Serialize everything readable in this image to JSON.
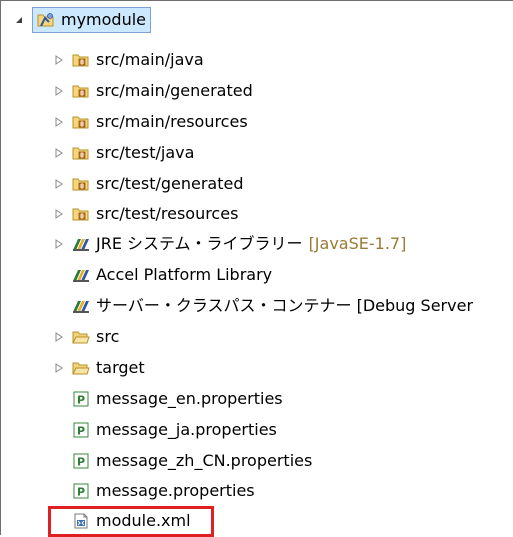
{
  "tree": {
    "root": {
      "label": "mymodule",
      "icon": "project-folder-icon",
      "expanded": true
    },
    "items": [
      {
        "label": "src/main/java",
        "icon": "source-folder-icon",
        "expandable": true
      },
      {
        "label": "src/main/generated",
        "icon": "source-folder-icon",
        "expandable": true
      },
      {
        "label": "src/main/resources",
        "icon": "source-folder-icon",
        "expandable": true
      },
      {
        "label": "src/test/java",
        "icon": "source-folder-icon",
        "expandable": true
      },
      {
        "label": "src/test/generated",
        "icon": "source-folder-icon",
        "expandable": true
      },
      {
        "label": "src/test/resources",
        "icon": "source-folder-icon",
        "expandable": true
      },
      {
        "label": "JRE システム・ライブラリー",
        "decoration": "[JavaSE-1.7]",
        "icon": "library-icon",
        "expandable": true
      },
      {
        "label": "Accel Platform Library",
        "icon": "library-icon",
        "expandable": false
      },
      {
        "label": "サーバー・クラスパス・コンテナー [Debug Server",
        "icon": "library-icon",
        "expandable": false
      },
      {
        "label": "src",
        "icon": "folder-icon",
        "expandable": true
      },
      {
        "label": "target",
        "icon": "folder-icon",
        "expandable": true
      },
      {
        "label": "message_en.properties",
        "icon": "properties-file-icon",
        "expandable": false
      },
      {
        "label": "message_ja.properties",
        "icon": "properties-file-icon",
        "expandable": false
      },
      {
        "label": "message_zh_CN.properties",
        "icon": "properties-file-icon",
        "expandable": false
      },
      {
        "label": "message.properties",
        "icon": "properties-file-icon",
        "expandable": false
      },
      {
        "label": "module.xml",
        "icon": "xml-file-icon",
        "expandable": false,
        "highlighted": true
      }
    ]
  },
  "colors": {
    "highlight": "#e02020",
    "selection_bg": "#cce8ff",
    "decoration": "#9a7b34"
  }
}
